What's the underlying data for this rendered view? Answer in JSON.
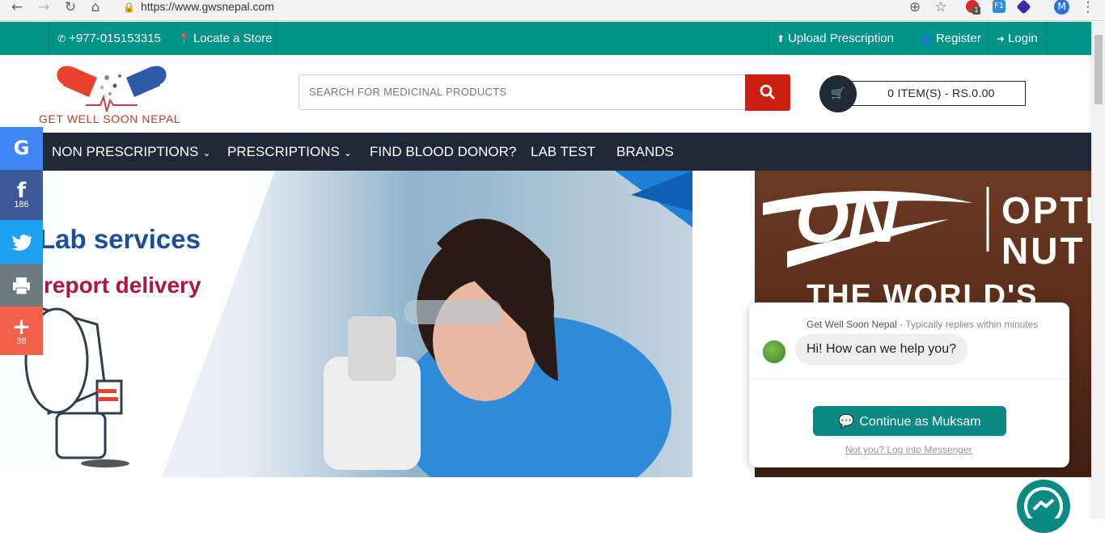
{
  "browser": {
    "url": "https://www.gwsnepal.com",
    "back_icon": "←",
    "forward_icon": "→",
    "reload_icon": "↻",
    "home_icon": "⌂",
    "zoom_icon": "⊕",
    "star_icon": "☆",
    "menu_icon": "⋮",
    "profile_initial": "M",
    "ext_badge": "1",
    "ext_label": "F1"
  },
  "topbar": {
    "phone": "+977-015153315",
    "locate": "Locate a Store",
    "upload": "Upload Prescription",
    "register": "Register",
    "login": "Login"
  },
  "header": {
    "logo_text": "GET WELL SOON NEPAL",
    "search_placeholder": "SEARCH FOR MEDICINAL PRODUCTS",
    "cart_summary": "0 ITEM(S) - RS.0.00"
  },
  "nav": {
    "items": [
      {
        "label": "NON PRESCRIPTIONS"
      },
      {
        "label": "PRESCRIPTIONS"
      },
      {
        "label": "FIND BLOOD DONOR?"
      },
      {
        "label": "LAB TEST"
      },
      {
        "label": "BRANDS"
      }
    ]
  },
  "banner_left": {
    "line1": "Lab services",
    "line2": "report delivery"
  },
  "banner_right": {
    "brand": "ON",
    "line1": "OPTI",
    "line2": "NUT",
    "line3": "THE WORLD'S"
  },
  "share": {
    "facebook_count": "186",
    "more_count": "38",
    "google_glyph": "G",
    "facebook_glyph": "f",
    "more_glyph": "+"
  },
  "messenger": {
    "page_name": "Get Well Soon Nepal",
    "reply_time": "Typically replies within minutes",
    "greeting": "Hi! How can we help you?",
    "continue_label": "Continue as Muksam",
    "not_you": "Not you? Log into Messenger"
  },
  "colors": {
    "teal": "#009489",
    "navy": "#1f2a36",
    "search_red": "#cc1f12",
    "messenger_teal": "#0a8a82"
  }
}
